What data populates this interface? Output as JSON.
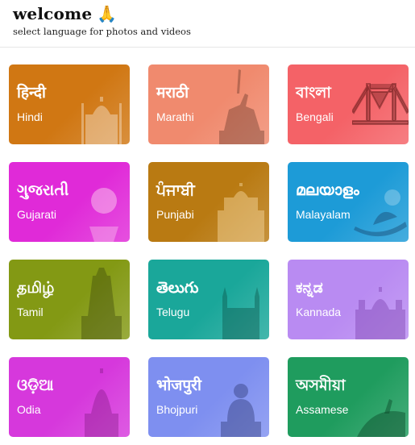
{
  "header": {
    "title": "welcome",
    "wave_icon": "🙏",
    "subtitle": "select language for photos and videos"
  },
  "languages": [
    {
      "native": "हिन्दी",
      "english": "Hindi",
      "color": "#d07713",
      "icon": "taj-mahal-icon"
    },
    {
      "native": "मराठी",
      "english": "Marathi",
      "color": "#f08a6e",
      "icon": "shivaji-statue-icon"
    },
    {
      "native": "বাংলা",
      "english": "Bengali",
      "color": "#f46267",
      "icon": "howrah-bridge-icon"
    },
    {
      "native": "ગુજરાતી",
      "english": "Gujarati",
      "color": "#e02ad8",
      "icon": "gujarati-pot-icon"
    },
    {
      "native": "ਪੰਜਾਬੀ",
      "english": "Punjabi",
      "color": "#b97a12",
      "icon": "golden-temple-icon"
    },
    {
      "native": "മലയാളം",
      "english": "Malayalam",
      "color": "#1d9bd7",
      "icon": "kerala-boat-icon"
    },
    {
      "native": "தமிழ்",
      "english": "Tamil",
      "color": "#839914",
      "icon": "temple-gopuram-icon"
    },
    {
      "native": "తెలుగు",
      "english": "Telugu",
      "color": "#1aa79a",
      "icon": "charminar-icon"
    },
    {
      "native": "ಕನ್ನಡ",
      "english": "Kannada",
      "color": "#b98bf2",
      "icon": "mysore-palace-icon"
    },
    {
      "native": "ଓଡ଼ିଆ",
      "english": "Odia",
      "color": "#d638dc",
      "icon": "odia-temple-icon"
    },
    {
      "native": "भोजपुरी",
      "english": "Bhojpuri",
      "color": "#7e8ff0",
      "icon": "buddha-statue-icon"
    },
    {
      "native": "অসমীয়া",
      "english": "Assamese",
      "color": "#1f9c5e",
      "icon": "assam-tea-icon"
    }
  ]
}
